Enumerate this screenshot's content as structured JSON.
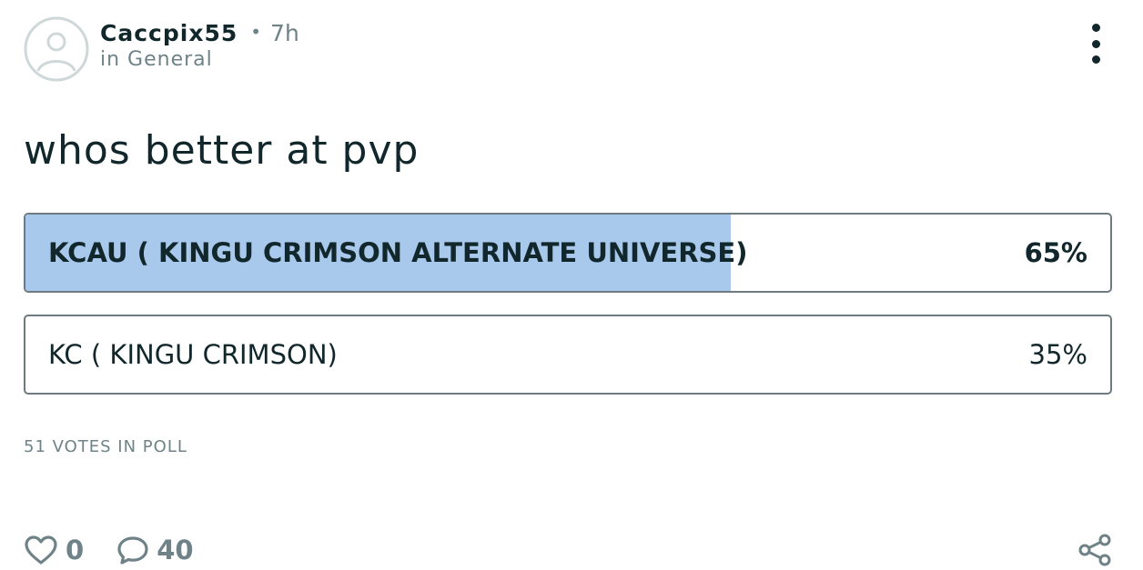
{
  "post": {
    "author": "Caccpix55",
    "separator": "•",
    "time": "7h",
    "community": "in General",
    "title": "whos better at pvp"
  },
  "poll": {
    "options": [
      {
        "label": "KCAU ( KINGU CRIMSON ALTERNATE UNIVERSE)",
        "percent": 65,
        "percent_text": "65%",
        "leading": true
      },
      {
        "label": "KC ( KINGU CRIMSON)",
        "percent": 35,
        "percent_text": "35%",
        "leading": false
      }
    ],
    "votes_text": "51 VOTES IN POLL"
  },
  "footer": {
    "likes": "0",
    "comments": "40"
  },
  "icons": {
    "avatar": "user-avatar-icon",
    "more": "more-vertical-icon",
    "like": "heart-icon",
    "comment": "comment-bubble-icon",
    "share": "share-icon"
  },
  "colors": {
    "text": "#11272b",
    "muted": "#6f8287",
    "poll_fill": "#a8c8ec",
    "border": "#6d7b80"
  }
}
